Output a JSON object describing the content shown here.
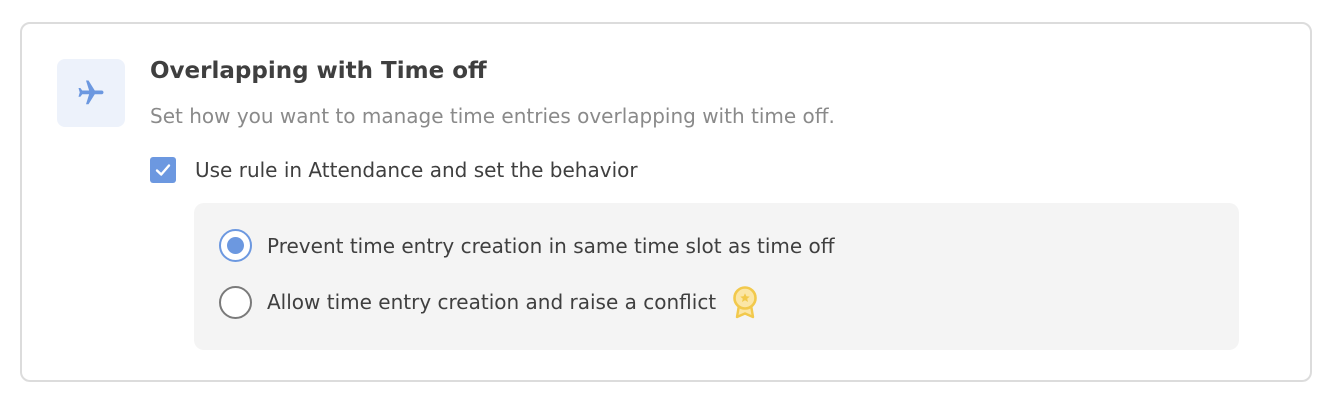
{
  "setting": {
    "icon": "airplane-icon",
    "title": "Overlapping with Time off",
    "description": "Set how you want to manage time entries overlapping with time off."
  },
  "rule_checkbox": {
    "label": "Use rule in Attendance and set the behavior",
    "checked": true
  },
  "behavior_options": [
    {
      "label": "Prevent time entry creation in same time slot as time off",
      "selected": true
    },
    {
      "label": "Allow time entry creation and raise a conflict",
      "selected": false,
      "badge_icon": "premium-badge-icon"
    }
  ],
  "colors": {
    "accent": "#6c98e0",
    "icon_tile_bg": "#edf2fb",
    "panel_bg": "#f4f4f4",
    "badge": "#f2c94c"
  }
}
